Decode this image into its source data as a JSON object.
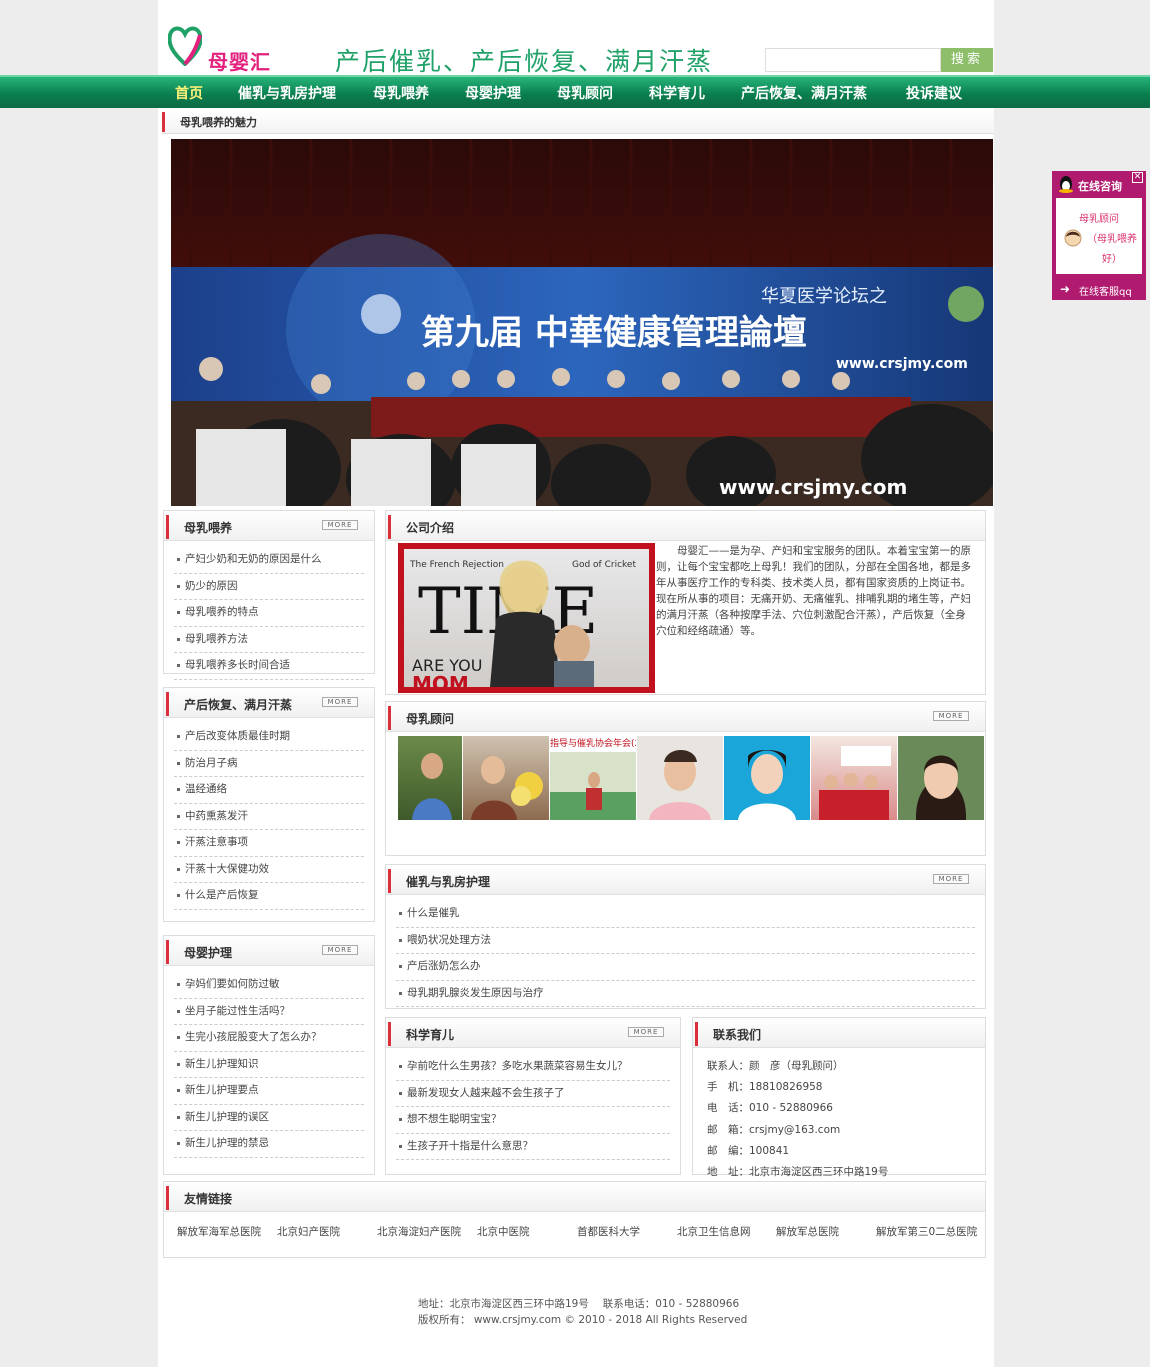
{
  "header": {
    "logo_text": "母婴汇",
    "slogan": "产后催乳、产后恢复、满月汗蒸",
    "search_placeholder": "",
    "search_button": "搜索"
  },
  "nav": {
    "items": [
      "首页",
      "催乳与乳房护理",
      "母乳喂养",
      "母婴护理",
      "母乳顾问",
      "科学育儿",
      "产后恢复、满月汗蒸",
      "投诉建议"
    ]
  },
  "banner": {
    "title": "母乳喂养的魅力",
    "forum_caption": "华夏医学论坛之",
    "forum_title": "第九届 中華健康管理論壇",
    "watermark": "www.crsjmy.com"
  },
  "sections": {
    "breastfeeding": {
      "title": "母乳喂养",
      "more": "MORE",
      "items": [
        "产妇少奶和无奶的原因是什么",
        "奶少的原因",
        "母乳喂养的特点",
        "母乳喂养方法",
        "母乳喂养多长时间合适"
      ]
    },
    "recovery": {
      "title": "产后恢复、满月汗蒸",
      "more": "MORE",
      "items": [
        "产后改变体质最佳时期",
        "防治月子病",
        "温经通络",
        "中药熏蒸发汗",
        "汗蒸注意事项",
        "汗蒸十大保健功效",
        "什么是产后恢复"
      ]
    },
    "care": {
      "title": "母婴护理",
      "more": "MORE",
      "items": [
        "孕妈们要如何防过敏",
        "坐月子能过性生活吗？",
        "生完小孩屁股变大了怎么办？",
        "新生儿护理知识",
        "新生儿护理要点",
        "新生儿护理的误区",
        "新生儿护理的禁忌"
      ]
    },
    "company": {
      "title": "公司介绍",
      "text": "母婴汇——是为孕、产妇和宝宝服务的团队。本着宝宝第一的原则，让每个宝宝都吃上母乳！我们的团队，分部在全国各地，都是多年从事医疗工作的专科类、技术类人员，都有国家资质的上岗证书。现在所从事的项目：无痛开奶、无痛催乳、排哺乳期的堵生等，产妇的满月汗蒸（各种按摩手法、穴位刺激配合汗蒸），产后恢复（全身穴位和经络疏通）等。",
      "image_texts": {
        "headline_left": "The French Rejection",
        "headline_right": "God of Cricket",
        "masthead": "TIME",
        "cover_line": "ARE YOU",
        "cover_line2": "MOM"
      }
    },
    "advisors": {
      "title": "母乳顾问",
      "more": "MORE",
      "photo_caption": "指导与催乳协会年会(2"
    },
    "lactation": {
      "title": "催乳与乳房护理",
      "more": "MORE",
      "items": [
        "什么是催乳",
        "喂奶状况处理方法",
        "产后涨奶怎么办",
        "母乳期乳腺炎发生原因与治疗"
      ]
    },
    "parenting": {
      "title": "科学育儿",
      "more": "MORE",
      "items": [
        "孕前吃什么生男孩？多吃水果蔬菜容易生女儿？",
        "最新发现女人越来越不会生孩子了",
        "想不想生聪明宝宝？",
        "生孩子开十指是什么意思？"
      ]
    },
    "contact": {
      "title": "联系我们",
      "lines": [
        "联系人：颜　彦（母乳顾问）",
        "手　机：18810826958",
        "电　话：010 - 52880966",
        "邮　箱：crsjmy@163.com",
        "邮　编：100841",
        "地　址：北京市海淀区西三环中路19号"
      ]
    },
    "friend_links": {
      "title": "友情链接",
      "items": [
        "解放军海军总医院",
        "北京妇产医院",
        "北京海淀妇产医院",
        "北京中医院",
        "首都医科大学",
        "北京卫生信息网",
        "解放军总医院",
        "解放军第三0二总医院"
      ]
    }
  },
  "footer": {
    "line1": "地址：北京市海淀区西三环中路19号　 联系电话：010 - 52880966",
    "line2": "版权所有： www.crsjmy.com © 2010 - 2018 All Rights Reserved"
  },
  "qq_widget": {
    "header": "在线咨询",
    "advisor": "母乳顾问",
    "advisor_sub": "（母乳喂养好）",
    "footer": "在线客服qq"
  },
  "colors": {
    "nav_green": "#0a7f4f",
    "active_nav": "#fff27a",
    "brand_pink": "#e3207e",
    "slogan_green": "#1fa168",
    "title_bar_red": "#d9303c",
    "qq_purple": "#b01a6f"
  }
}
